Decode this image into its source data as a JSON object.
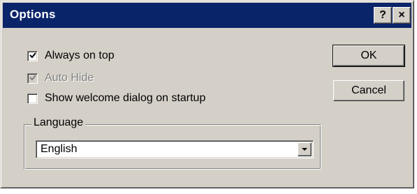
{
  "window": {
    "title": "Options",
    "help_glyph": "?",
    "close_glyph": "×"
  },
  "options": {
    "always_on_top": {
      "label": "Always on top",
      "checked": true,
      "enabled": true
    },
    "auto_hide": {
      "label": "Auto Hide",
      "checked": true,
      "enabled": false
    },
    "show_welcome": {
      "label": "Show welcome dialog on startup",
      "checked": false,
      "enabled": true
    }
  },
  "language": {
    "group_label": "Language",
    "selected": "English"
  },
  "buttons": {
    "ok": "OK",
    "cancel": "Cancel"
  },
  "colors": {
    "titlebar": "#0a246a",
    "face": "#d4d0c8"
  },
  "icons": {
    "help": "help-icon",
    "close": "close-icon",
    "dropdown": "chevron-down-icon",
    "checkmark": "checkmark-icon"
  }
}
